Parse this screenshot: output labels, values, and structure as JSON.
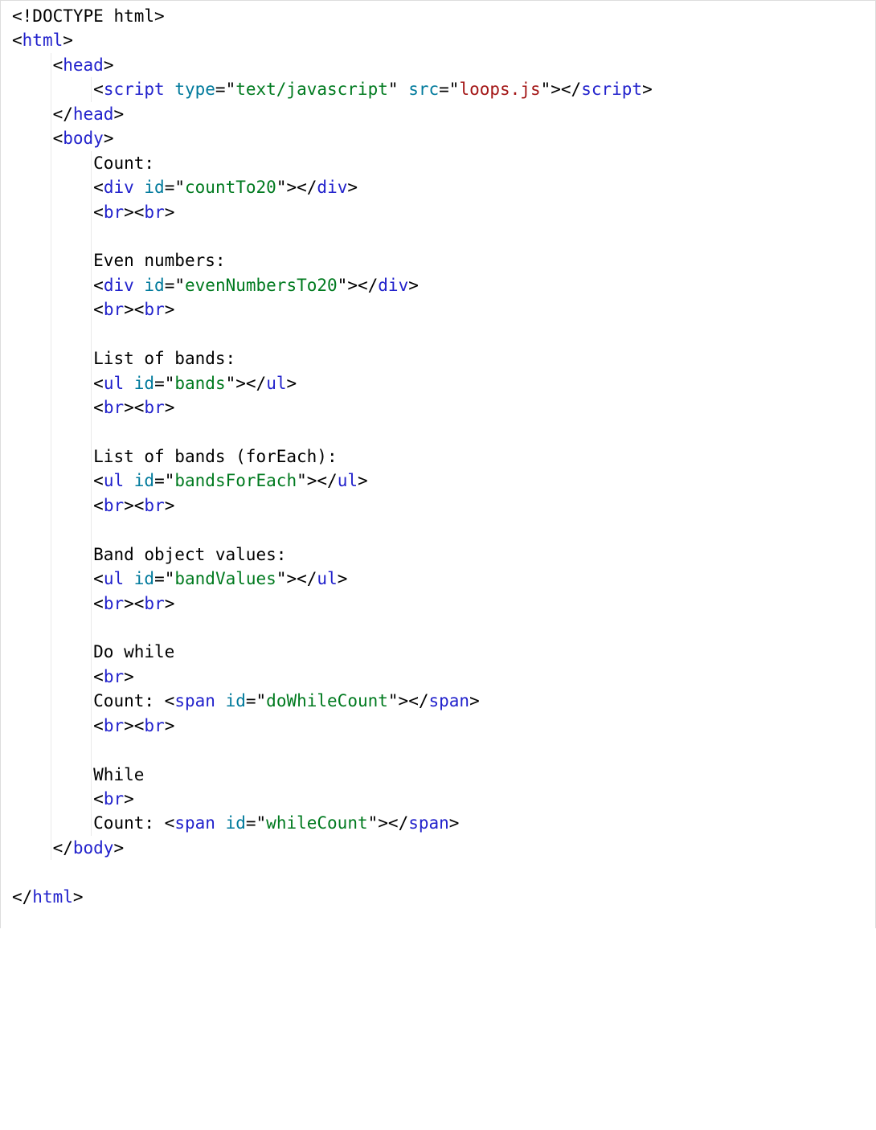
{
  "code": {
    "lines": [
      {
        "indent": 0,
        "guides": [],
        "tokens": [
          {
            "c": "t-punc",
            "t": "<!"
          },
          {
            "c": "t-doctype",
            "t": "DOCTYPE html"
          },
          {
            "c": "t-punc",
            "t": ">"
          }
        ]
      },
      {
        "indent": 0,
        "guides": [],
        "tokens": [
          {
            "c": "t-punc",
            "t": "<"
          },
          {
            "c": "t-tag",
            "t": "html"
          },
          {
            "c": "t-punc",
            "t": ">"
          }
        ]
      },
      {
        "indent": 1,
        "guides": [
          1
        ],
        "tokens": [
          {
            "c": "t-punc",
            "t": "<"
          },
          {
            "c": "t-tag",
            "t": "head"
          },
          {
            "c": "t-punc",
            "t": ">"
          }
        ]
      },
      {
        "indent": 2,
        "guides": [
          1,
          2
        ],
        "tokens": [
          {
            "c": "t-punc",
            "t": "<"
          },
          {
            "c": "t-tag",
            "t": "script"
          },
          {
            "c": "t-text",
            "t": " "
          },
          {
            "c": "t-attr",
            "t": "type"
          },
          {
            "c": "t-eq",
            "t": "="
          },
          {
            "c": "t-punc",
            "t": "\""
          },
          {
            "c": "t-str2",
            "t": "text/javascript"
          },
          {
            "c": "t-punc",
            "t": "\""
          },
          {
            "c": "t-text",
            "t": " "
          },
          {
            "c": "t-attr",
            "t": "src"
          },
          {
            "c": "t-eq",
            "t": "="
          },
          {
            "c": "t-punc",
            "t": "\""
          },
          {
            "c": "t-str",
            "t": "loops.js"
          },
          {
            "c": "t-punc",
            "t": "\""
          },
          {
            "c": "t-punc",
            "t": ">"
          },
          {
            "c": "t-punc",
            "t": "</"
          },
          {
            "c": "t-tag",
            "t": "script"
          },
          {
            "c": "t-punc",
            "t": ">"
          }
        ]
      },
      {
        "indent": 1,
        "guides": [
          1
        ],
        "tokens": [
          {
            "c": "t-punc",
            "t": "</"
          },
          {
            "c": "t-tag",
            "t": "head"
          },
          {
            "c": "t-punc",
            "t": ">"
          }
        ]
      },
      {
        "indent": 1,
        "guides": [
          1
        ],
        "tokens": [
          {
            "c": "t-punc",
            "t": "<"
          },
          {
            "c": "t-tag",
            "t": "body"
          },
          {
            "c": "t-punc",
            "t": ">"
          }
        ]
      },
      {
        "indent": 2,
        "guides": [
          1,
          2
        ],
        "tokens": [
          {
            "c": "t-text",
            "t": "Count:"
          }
        ]
      },
      {
        "indent": 2,
        "guides": [
          1,
          2
        ],
        "tokens": [
          {
            "c": "t-punc",
            "t": "<"
          },
          {
            "c": "t-tag",
            "t": "div"
          },
          {
            "c": "t-text",
            "t": " "
          },
          {
            "c": "t-attr",
            "t": "id"
          },
          {
            "c": "t-eq",
            "t": "="
          },
          {
            "c": "t-punc",
            "t": "\""
          },
          {
            "c": "t-str2",
            "t": "countTo20"
          },
          {
            "c": "t-punc",
            "t": "\""
          },
          {
            "c": "t-punc",
            "t": ">"
          },
          {
            "c": "t-punc",
            "t": "</"
          },
          {
            "c": "t-tag",
            "t": "div"
          },
          {
            "c": "t-punc",
            "t": ">"
          }
        ]
      },
      {
        "indent": 2,
        "guides": [
          1,
          2
        ],
        "tokens": [
          {
            "c": "t-punc",
            "t": "<"
          },
          {
            "c": "t-tag",
            "t": "br"
          },
          {
            "c": "t-punc",
            "t": ">"
          },
          {
            "c": "t-punc",
            "t": "<"
          },
          {
            "c": "t-tag",
            "t": "br"
          },
          {
            "c": "t-punc",
            "t": ">"
          }
        ]
      },
      {
        "indent": 0,
        "guides": [
          1,
          2
        ],
        "tokens": []
      },
      {
        "indent": 2,
        "guides": [
          1,
          2
        ],
        "tokens": [
          {
            "c": "t-text",
            "t": "Even numbers:"
          }
        ]
      },
      {
        "indent": 2,
        "guides": [
          1,
          2
        ],
        "tokens": [
          {
            "c": "t-punc",
            "t": "<"
          },
          {
            "c": "t-tag",
            "t": "div"
          },
          {
            "c": "t-text",
            "t": " "
          },
          {
            "c": "t-attr",
            "t": "id"
          },
          {
            "c": "t-eq",
            "t": "="
          },
          {
            "c": "t-punc",
            "t": "\""
          },
          {
            "c": "t-str2",
            "t": "evenNumbersTo20"
          },
          {
            "c": "t-punc",
            "t": "\""
          },
          {
            "c": "t-punc",
            "t": ">"
          },
          {
            "c": "t-punc",
            "t": "</"
          },
          {
            "c": "t-tag",
            "t": "div"
          },
          {
            "c": "t-punc",
            "t": ">"
          }
        ]
      },
      {
        "indent": 2,
        "guides": [
          1,
          2
        ],
        "tokens": [
          {
            "c": "t-punc",
            "t": "<"
          },
          {
            "c": "t-tag",
            "t": "br"
          },
          {
            "c": "t-punc",
            "t": ">"
          },
          {
            "c": "t-punc",
            "t": "<"
          },
          {
            "c": "t-tag",
            "t": "br"
          },
          {
            "c": "t-punc",
            "t": ">"
          }
        ]
      },
      {
        "indent": 0,
        "guides": [
          1,
          2
        ],
        "tokens": []
      },
      {
        "indent": 2,
        "guides": [
          1,
          2
        ],
        "tokens": [
          {
            "c": "t-text",
            "t": "List of bands:"
          }
        ]
      },
      {
        "indent": 2,
        "guides": [
          1,
          2
        ],
        "tokens": [
          {
            "c": "t-punc",
            "t": "<"
          },
          {
            "c": "t-tag",
            "t": "ul"
          },
          {
            "c": "t-text",
            "t": " "
          },
          {
            "c": "t-attr",
            "t": "id"
          },
          {
            "c": "t-eq",
            "t": "="
          },
          {
            "c": "t-punc",
            "t": "\""
          },
          {
            "c": "t-str2",
            "t": "bands"
          },
          {
            "c": "t-punc",
            "t": "\""
          },
          {
            "c": "t-punc",
            "t": ">"
          },
          {
            "c": "t-punc",
            "t": "</"
          },
          {
            "c": "t-tag",
            "t": "ul"
          },
          {
            "c": "t-punc",
            "t": ">"
          }
        ]
      },
      {
        "indent": 2,
        "guides": [
          1,
          2
        ],
        "tokens": [
          {
            "c": "t-punc",
            "t": "<"
          },
          {
            "c": "t-tag",
            "t": "br"
          },
          {
            "c": "t-punc",
            "t": ">"
          },
          {
            "c": "t-punc",
            "t": "<"
          },
          {
            "c": "t-tag",
            "t": "br"
          },
          {
            "c": "t-punc",
            "t": ">"
          }
        ]
      },
      {
        "indent": 0,
        "guides": [
          1,
          2
        ],
        "tokens": []
      },
      {
        "indent": 2,
        "guides": [
          1,
          2
        ],
        "tokens": [
          {
            "c": "t-text",
            "t": "List of bands (forEach):"
          }
        ]
      },
      {
        "indent": 2,
        "guides": [
          1,
          2
        ],
        "tokens": [
          {
            "c": "t-punc",
            "t": "<"
          },
          {
            "c": "t-tag",
            "t": "ul"
          },
          {
            "c": "t-text",
            "t": " "
          },
          {
            "c": "t-attr",
            "t": "id"
          },
          {
            "c": "t-eq",
            "t": "="
          },
          {
            "c": "t-punc",
            "t": "\""
          },
          {
            "c": "t-str2",
            "t": "bandsForEach"
          },
          {
            "c": "t-punc",
            "t": "\""
          },
          {
            "c": "t-punc",
            "t": ">"
          },
          {
            "c": "t-punc",
            "t": "</"
          },
          {
            "c": "t-tag",
            "t": "ul"
          },
          {
            "c": "t-punc",
            "t": ">"
          }
        ]
      },
      {
        "indent": 2,
        "guides": [
          1,
          2
        ],
        "tokens": [
          {
            "c": "t-punc",
            "t": "<"
          },
          {
            "c": "t-tag",
            "t": "br"
          },
          {
            "c": "t-punc",
            "t": ">"
          },
          {
            "c": "t-punc",
            "t": "<"
          },
          {
            "c": "t-tag",
            "t": "br"
          },
          {
            "c": "t-punc",
            "t": ">"
          }
        ]
      },
      {
        "indent": 0,
        "guides": [
          1,
          2
        ],
        "tokens": []
      },
      {
        "indent": 2,
        "guides": [
          1,
          2
        ],
        "tokens": [
          {
            "c": "t-text",
            "t": "Band object values:"
          }
        ]
      },
      {
        "indent": 2,
        "guides": [
          1,
          2
        ],
        "tokens": [
          {
            "c": "t-punc",
            "t": "<"
          },
          {
            "c": "t-tag",
            "t": "ul"
          },
          {
            "c": "t-text",
            "t": " "
          },
          {
            "c": "t-attr",
            "t": "id"
          },
          {
            "c": "t-eq",
            "t": "="
          },
          {
            "c": "t-punc",
            "t": "\""
          },
          {
            "c": "t-str2",
            "t": "bandValues"
          },
          {
            "c": "t-punc",
            "t": "\""
          },
          {
            "c": "t-punc",
            "t": ">"
          },
          {
            "c": "t-punc",
            "t": "</"
          },
          {
            "c": "t-tag",
            "t": "ul"
          },
          {
            "c": "t-punc",
            "t": ">"
          }
        ]
      },
      {
        "indent": 2,
        "guides": [
          1,
          2
        ],
        "tokens": [
          {
            "c": "t-punc",
            "t": "<"
          },
          {
            "c": "t-tag",
            "t": "br"
          },
          {
            "c": "t-punc",
            "t": ">"
          },
          {
            "c": "t-punc",
            "t": "<"
          },
          {
            "c": "t-tag",
            "t": "br"
          },
          {
            "c": "t-punc",
            "t": ">"
          }
        ]
      },
      {
        "indent": 0,
        "guides": [
          1,
          2
        ],
        "tokens": []
      },
      {
        "indent": 2,
        "guides": [
          1,
          2
        ],
        "tokens": [
          {
            "c": "t-text",
            "t": "Do while"
          }
        ]
      },
      {
        "indent": 2,
        "guides": [
          1,
          2
        ],
        "tokens": [
          {
            "c": "t-punc",
            "t": "<"
          },
          {
            "c": "t-tag",
            "t": "br"
          },
          {
            "c": "t-punc",
            "t": ">"
          }
        ]
      },
      {
        "indent": 2,
        "guides": [
          1,
          2
        ],
        "tokens": [
          {
            "c": "t-text",
            "t": "Count: "
          },
          {
            "c": "t-punc",
            "t": "<"
          },
          {
            "c": "t-tag",
            "t": "span"
          },
          {
            "c": "t-text",
            "t": " "
          },
          {
            "c": "t-attr",
            "t": "id"
          },
          {
            "c": "t-eq",
            "t": "="
          },
          {
            "c": "t-punc",
            "t": "\""
          },
          {
            "c": "t-str2",
            "t": "doWhileCount"
          },
          {
            "c": "t-punc",
            "t": "\""
          },
          {
            "c": "t-punc",
            "t": ">"
          },
          {
            "c": "t-punc",
            "t": "</"
          },
          {
            "c": "t-tag",
            "t": "span"
          },
          {
            "c": "t-punc",
            "t": ">"
          }
        ]
      },
      {
        "indent": 2,
        "guides": [
          1,
          2
        ],
        "tokens": [
          {
            "c": "t-punc",
            "t": "<"
          },
          {
            "c": "t-tag",
            "t": "br"
          },
          {
            "c": "t-punc",
            "t": ">"
          },
          {
            "c": "t-punc",
            "t": "<"
          },
          {
            "c": "t-tag",
            "t": "br"
          },
          {
            "c": "t-punc",
            "t": ">"
          }
        ]
      },
      {
        "indent": 0,
        "guides": [
          1,
          2
        ],
        "tokens": []
      },
      {
        "indent": 2,
        "guides": [
          1,
          2
        ],
        "tokens": [
          {
            "c": "t-text",
            "t": "While"
          }
        ]
      },
      {
        "indent": 2,
        "guides": [
          1,
          2
        ],
        "tokens": [
          {
            "c": "t-punc",
            "t": "<"
          },
          {
            "c": "t-tag",
            "t": "br"
          },
          {
            "c": "t-punc",
            "t": ">"
          }
        ]
      },
      {
        "indent": 2,
        "guides": [
          1,
          2
        ],
        "tokens": [
          {
            "c": "t-text",
            "t": "Count: "
          },
          {
            "c": "t-punc",
            "t": "<"
          },
          {
            "c": "t-tag",
            "t": "span"
          },
          {
            "c": "t-text",
            "t": " "
          },
          {
            "c": "t-attr",
            "t": "id"
          },
          {
            "c": "t-eq",
            "t": "="
          },
          {
            "c": "t-punc",
            "t": "\""
          },
          {
            "c": "t-str2",
            "t": "whileCount"
          },
          {
            "c": "t-punc",
            "t": "\""
          },
          {
            "c": "t-punc",
            "t": ">"
          },
          {
            "c": "t-punc",
            "t": "</"
          },
          {
            "c": "t-tag",
            "t": "span"
          },
          {
            "c": "t-punc",
            "t": ">"
          }
        ]
      },
      {
        "indent": 1,
        "guides": [
          1
        ],
        "tokens": [
          {
            "c": "t-punc",
            "t": "</"
          },
          {
            "c": "t-tag",
            "t": "body"
          },
          {
            "c": "t-punc",
            "t": ">"
          }
        ]
      },
      {
        "indent": 0,
        "guides": [],
        "tokens": []
      },
      {
        "indent": 0,
        "guides": [],
        "tokens": [
          {
            "c": "t-punc",
            "t": "</"
          },
          {
            "c": "t-tag",
            "t": "html"
          },
          {
            "c": "t-punc",
            "t": ">"
          }
        ]
      }
    ]
  }
}
